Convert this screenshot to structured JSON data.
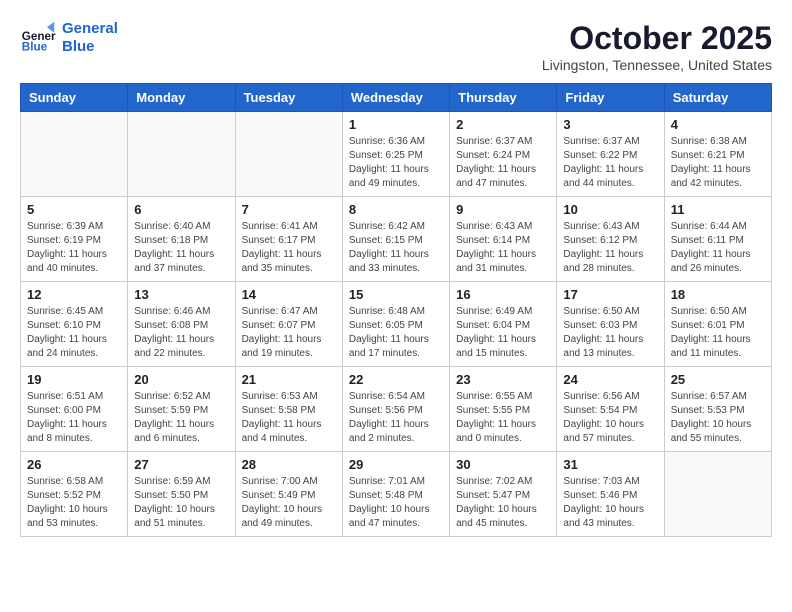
{
  "header": {
    "logo_line1": "General",
    "logo_line2": "Blue",
    "month": "October 2025",
    "location": "Livingston, Tennessee, United States"
  },
  "weekdays": [
    "Sunday",
    "Monday",
    "Tuesday",
    "Wednesday",
    "Thursday",
    "Friday",
    "Saturday"
  ],
  "weeks": [
    [
      {
        "day": "",
        "info": ""
      },
      {
        "day": "",
        "info": ""
      },
      {
        "day": "",
        "info": ""
      },
      {
        "day": "1",
        "info": "Sunrise: 6:36 AM\nSunset: 6:25 PM\nDaylight: 11 hours\nand 49 minutes."
      },
      {
        "day": "2",
        "info": "Sunrise: 6:37 AM\nSunset: 6:24 PM\nDaylight: 11 hours\nand 47 minutes."
      },
      {
        "day": "3",
        "info": "Sunrise: 6:37 AM\nSunset: 6:22 PM\nDaylight: 11 hours\nand 44 minutes."
      },
      {
        "day": "4",
        "info": "Sunrise: 6:38 AM\nSunset: 6:21 PM\nDaylight: 11 hours\nand 42 minutes."
      }
    ],
    [
      {
        "day": "5",
        "info": "Sunrise: 6:39 AM\nSunset: 6:19 PM\nDaylight: 11 hours\nand 40 minutes."
      },
      {
        "day": "6",
        "info": "Sunrise: 6:40 AM\nSunset: 6:18 PM\nDaylight: 11 hours\nand 37 minutes."
      },
      {
        "day": "7",
        "info": "Sunrise: 6:41 AM\nSunset: 6:17 PM\nDaylight: 11 hours\nand 35 minutes."
      },
      {
        "day": "8",
        "info": "Sunrise: 6:42 AM\nSunset: 6:15 PM\nDaylight: 11 hours\nand 33 minutes."
      },
      {
        "day": "9",
        "info": "Sunrise: 6:43 AM\nSunset: 6:14 PM\nDaylight: 11 hours\nand 31 minutes."
      },
      {
        "day": "10",
        "info": "Sunrise: 6:43 AM\nSunset: 6:12 PM\nDaylight: 11 hours\nand 28 minutes."
      },
      {
        "day": "11",
        "info": "Sunrise: 6:44 AM\nSunset: 6:11 PM\nDaylight: 11 hours\nand 26 minutes."
      }
    ],
    [
      {
        "day": "12",
        "info": "Sunrise: 6:45 AM\nSunset: 6:10 PM\nDaylight: 11 hours\nand 24 minutes."
      },
      {
        "day": "13",
        "info": "Sunrise: 6:46 AM\nSunset: 6:08 PM\nDaylight: 11 hours\nand 22 minutes."
      },
      {
        "day": "14",
        "info": "Sunrise: 6:47 AM\nSunset: 6:07 PM\nDaylight: 11 hours\nand 19 minutes."
      },
      {
        "day": "15",
        "info": "Sunrise: 6:48 AM\nSunset: 6:05 PM\nDaylight: 11 hours\nand 17 minutes."
      },
      {
        "day": "16",
        "info": "Sunrise: 6:49 AM\nSunset: 6:04 PM\nDaylight: 11 hours\nand 15 minutes."
      },
      {
        "day": "17",
        "info": "Sunrise: 6:50 AM\nSunset: 6:03 PM\nDaylight: 11 hours\nand 13 minutes."
      },
      {
        "day": "18",
        "info": "Sunrise: 6:50 AM\nSunset: 6:01 PM\nDaylight: 11 hours\nand 11 minutes."
      }
    ],
    [
      {
        "day": "19",
        "info": "Sunrise: 6:51 AM\nSunset: 6:00 PM\nDaylight: 11 hours\nand 8 minutes."
      },
      {
        "day": "20",
        "info": "Sunrise: 6:52 AM\nSunset: 5:59 PM\nDaylight: 11 hours\nand 6 minutes."
      },
      {
        "day": "21",
        "info": "Sunrise: 6:53 AM\nSunset: 5:58 PM\nDaylight: 11 hours\nand 4 minutes."
      },
      {
        "day": "22",
        "info": "Sunrise: 6:54 AM\nSunset: 5:56 PM\nDaylight: 11 hours\nand 2 minutes."
      },
      {
        "day": "23",
        "info": "Sunrise: 6:55 AM\nSunset: 5:55 PM\nDaylight: 11 hours\nand 0 minutes."
      },
      {
        "day": "24",
        "info": "Sunrise: 6:56 AM\nSunset: 5:54 PM\nDaylight: 10 hours\nand 57 minutes."
      },
      {
        "day": "25",
        "info": "Sunrise: 6:57 AM\nSunset: 5:53 PM\nDaylight: 10 hours\nand 55 minutes."
      }
    ],
    [
      {
        "day": "26",
        "info": "Sunrise: 6:58 AM\nSunset: 5:52 PM\nDaylight: 10 hours\nand 53 minutes."
      },
      {
        "day": "27",
        "info": "Sunrise: 6:59 AM\nSunset: 5:50 PM\nDaylight: 10 hours\nand 51 minutes."
      },
      {
        "day": "28",
        "info": "Sunrise: 7:00 AM\nSunset: 5:49 PM\nDaylight: 10 hours\nand 49 minutes."
      },
      {
        "day": "29",
        "info": "Sunrise: 7:01 AM\nSunset: 5:48 PM\nDaylight: 10 hours\nand 47 minutes."
      },
      {
        "day": "30",
        "info": "Sunrise: 7:02 AM\nSunset: 5:47 PM\nDaylight: 10 hours\nand 45 minutes."
      },
      {
        "day": "31",
        "info": "Sunrise: 7:03 AM\nSunset: 5:46 PM\nDaylight: 10 hours\nand 43 minutes."
      },
      {
        "day": "",
        "info": ""
      }
    ]
  ]
}
